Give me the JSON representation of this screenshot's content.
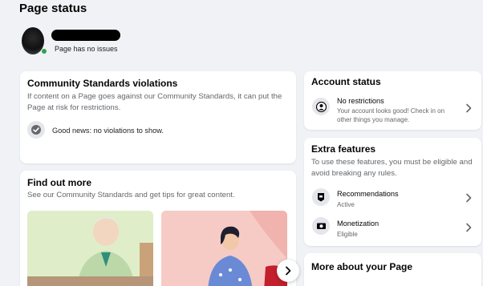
{
  "header": {
    "page_title": "Page status",
    "status_text": "Page has no issues"
  },
  "violations": {
    "title": "Community Standards violations",
    "description": "If content on a Page goes against our Community Standards, it can put the Page at risk for restrictions.",
    "good_news": "Good news: no violations to show."
  },
  "find_out_more": {
    "title": "Find out more",
    "description": "See our Community Standards and get tips for great content."
  },
  "account_status": {
    "title": "Account status",
    "item_title": "No restrictions",
    "item_desc": "Your account looks good! Check in on other things you manage."
  },
  "extra_features": {
    "title": "Extra features",
    "description": "To use these features, you must be eligible and avoid breaking any rules.",
    "items": [
      {
        "label": "Recommendations",
        "status": "Active"
      },
      {
        "label": "Monetization",
        "status": "Eligible"
      }
    ]
  },
  "more_about": {
    "title": "More about your Page"
  },
  "colors": {
    "background": "#f0f2f5",
    "card": "#ffffff",
    "online_dot": "#31a24c",
    "secondary_text": "#65676b"
  }
}
